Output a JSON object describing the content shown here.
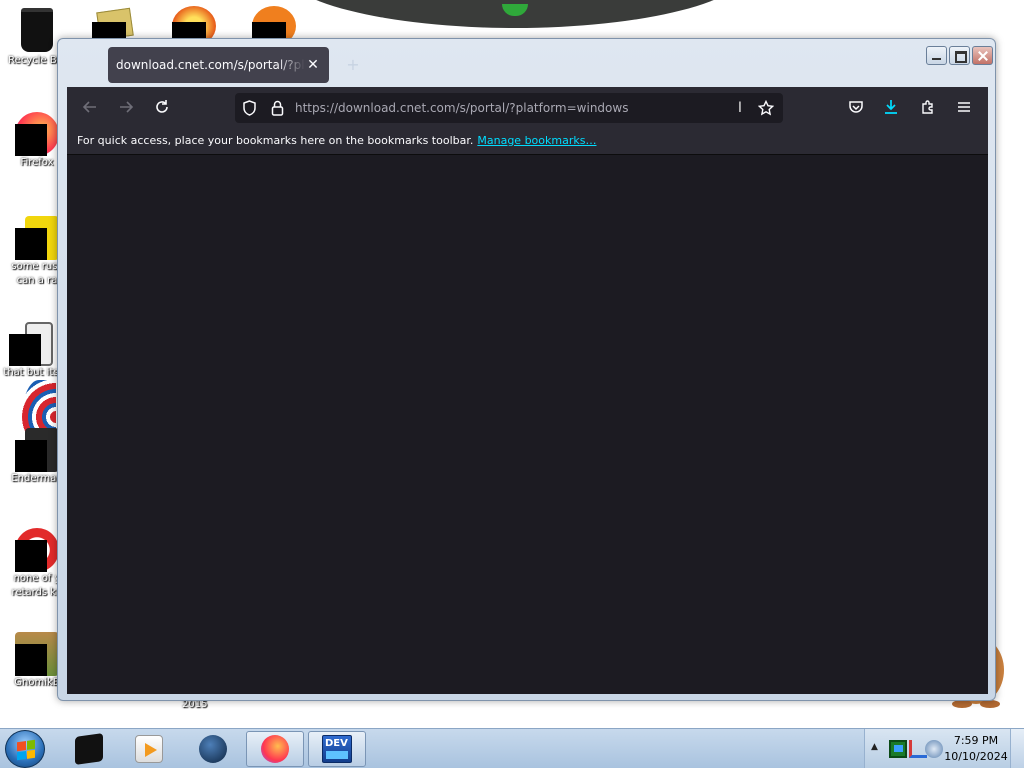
{
  "desktop": {
    "icons": [
      {
        "label": "Recycle Bin"
      },
      {
        "label": "Firefox"
      },
      {
        "label": "some russ"
      },
      {
        "label": "can a ra"
      },
      {
        "label": "that but its"
      },
      {
        "label": "Enderman"
      },
      {
        "label": "none of y"
      },
      {
        "label": "retards kn"
      },
      {
        "label": "GnomikB"
      }
    ],
    "stray_label": "2015"
  },
  "browser": {
    "tab": {
      "title": "download.cnet.com/s/portal/?platform=windows"
    },
    "new_tab_glyph": "+",
    "url_bar": {
      "url": "https://download.cnet.com/s/portal/?platform=windows"
    },
    "bookmarks_bar": {
      "message": "For quick access, place your bookmarks here on the bookmarks toolbar.",
      "link": "Manage bookmarks…"
    }
  },
  "taskbar": {
    "clock": {
      "time": "7:59 PM",
      "date": "10/10/2024"
    },
    "pinned": [
      "terminal",
      "media-player",
      "globe",
      "firefox",
      "dev-cpp"
    ],
    "devcpp_label": "DEV"
  },
  "colors": {
    "browser_bg": "#1c1b22",
    "toolbar_bg": "#2b2a33",
    "link": "#00ddff",
    "download_accent": "#00ddff"
  }
}
